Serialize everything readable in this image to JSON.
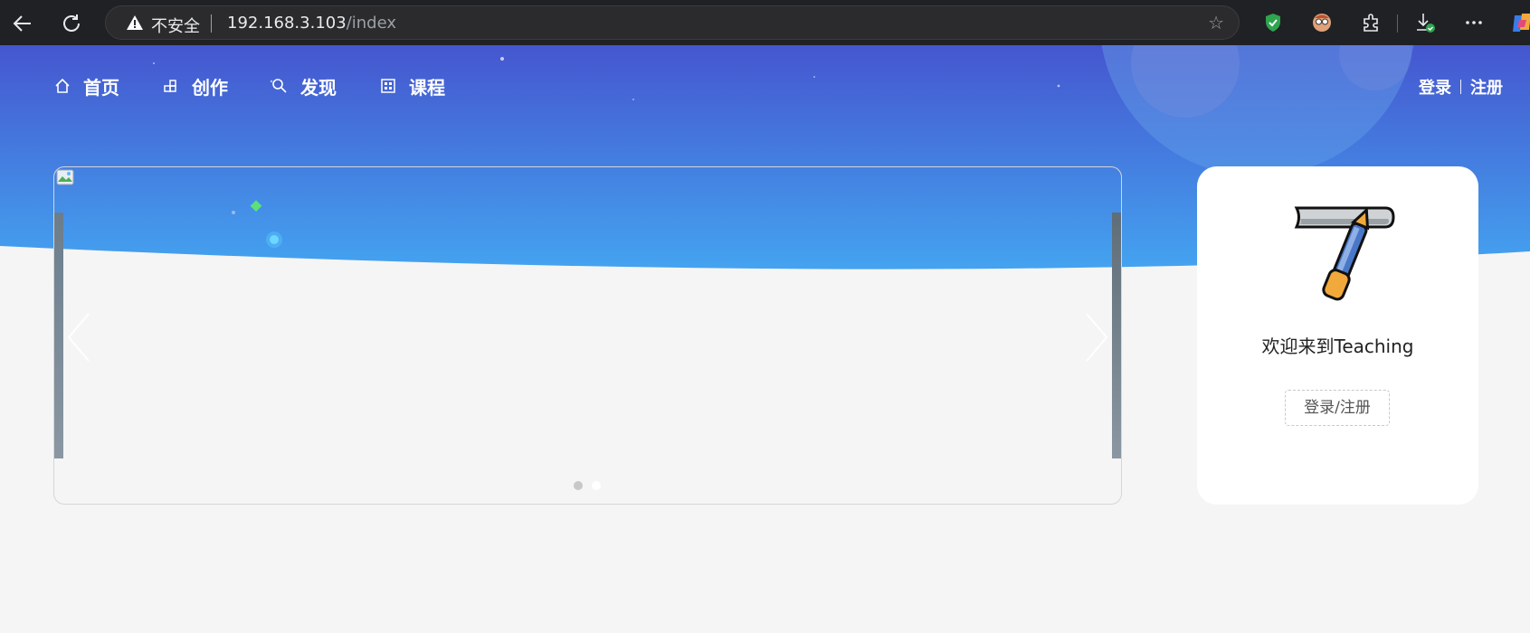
{
  "browser": {
    "back_icon": "arrow-left-icon",
    "reload_icon": "reload-icon",
    "security_label": "不安全",
    "url_host": "192.168.3.103",
    "url_path": "/index",
    "bookmark_icon": "star-icon",
    "extensions": [
      "shield-extension-icon",
      "avatar-extension-icon",
      "puzzle-icon",
      "download-icon",
      "more-icon",
      "copilot-icon"
    ]
  },
  "nav": {
    "items": [
      {
        "label": "首页",
        "icon": "home-icon"
      },
      {
        "label": "创作",
        "icon": "create-icon"
      },
      {
        "label": "发现",
        "icon": "search-icon"
      },
      {
        "label": "课程",
        "icon": "course-icon"
      }
    ],
    "login": "登录",
    "register": "注册"
  },
  "carousel": {
    "slide_count": 2,
    "active_slide": 1
  },
  "welcome_card": {
    "title": "欢迎来到Teaching",
    "button": "登录/注册"
  },
  "colors": {
    "hero_top": "#4556cf",
    "hero_bottom": "#44a3f0",
    "page_bg": "#f5f5f5",
    "chrome_bg": "#202124"
  }
}
